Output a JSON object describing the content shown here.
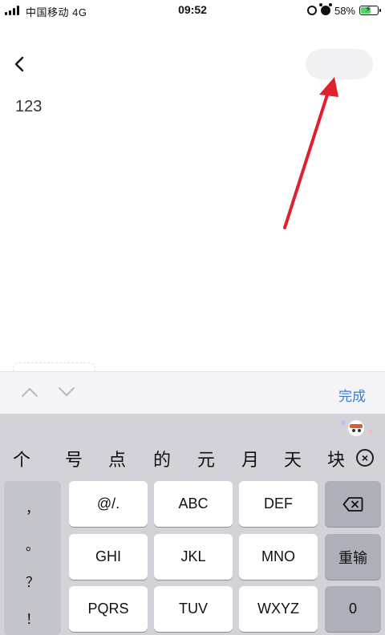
{
  "status_bar": {
    "carrier": "中国移动  4G",
    "time": "09:52",
    "battery": "58%",
    "battery_level": 0.58,
    "icons": [
      "signal-icon",
      "lock-rotation-icon",
      "alarm-icon",
      "battery-icon",
      "charging-icon"
    ]
  },
  "header": {
    "back_icon": "chevron-left-icon"
  },
  "editor": {
    "text": "123"
  },
  "toolbar": {
    "done_label": "完成",
    "up_icon": "chevron-up-icon",
    "down_icon": "chevron-down-icon"
  },
  "keyboard": {
    "candidates": [
      "个",
      "号",
      "点",
      "的",
      "元",
      "月",
      "天",
      "块"
    ],
    "punctuation": [
      "，",
      "。",
      "？",
      "！"
    ],
    "rows": [
      [
        "@/.",
        "ABC",
        "DEF"
      ],
      [
        "GHI",
        "JKL",
        "MNO"
      ],
      [
        "PQRS",
        "TUV",
        "WXYZ"
      ]
    ],
    "retype_label": "重输",
    "zero_label": "0",
    "backspace_icon": "backspace-icon",
    "clear_icon": "close-circle-icon"
  },
  "colors": {
    "accent": "#3a7bd5",
    "annotation_arrow": "#e0202d",
    "keyboard_bg": "#d2d2d8",
    "battery_fill": "#4cd964"
  }
}
